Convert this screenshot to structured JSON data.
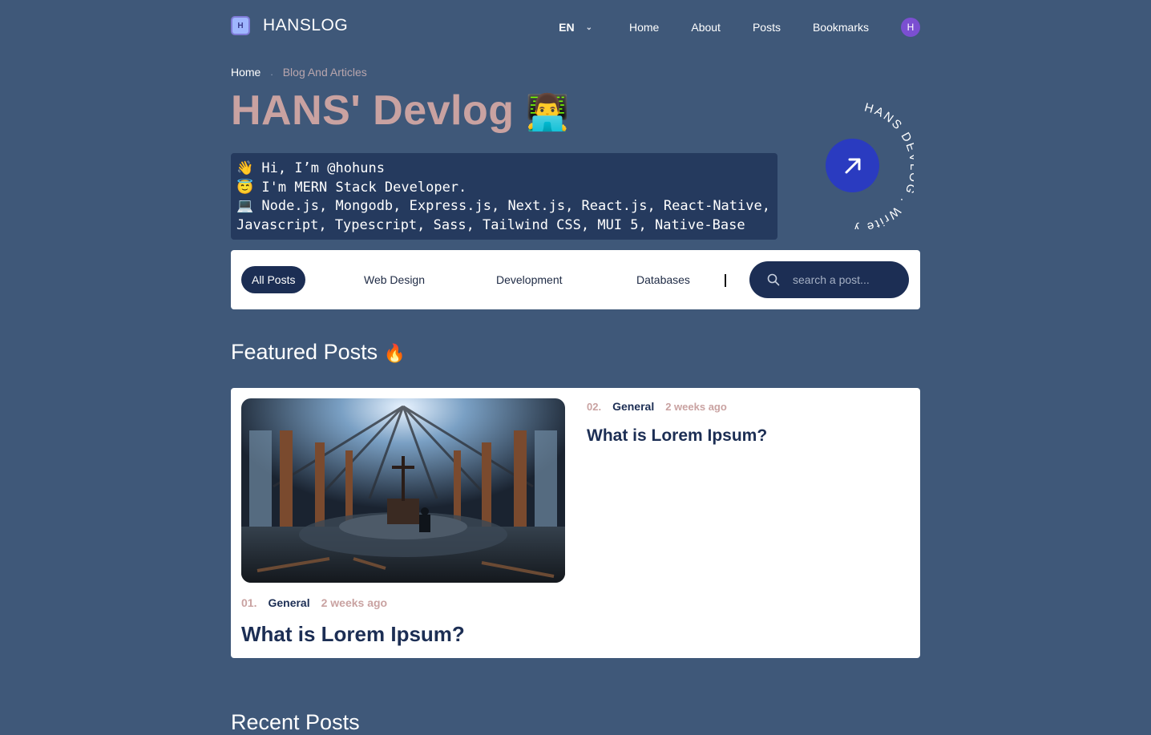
{
  "nav": {
    "logo_letter": "H",
    "brand": "HANSLOG",
    "language": "EN",
    "links": [
      "Home",
      "About",
      "Posts",
      "Bookmarks"
    ],
    "avatar_letter": "H"
  },
  "breadcrumb": {
    "home": "Home",
    "separator": ".",
    "current": "Blog And Articles"
  },
  "hero": {
    "title": "HANS' Devlog",
    "title_emoji": "👨‍💻",
    "intro_lines": [
      "👋 Hi, I’m @hohuns",
      "😇 I'm MERN Stack Developer.",
      "💻 Node.js, Mongodb, Express.js, Next.js, React.js, React-Native,",
      "Javascript, Typescript, Sass, Tailwind CSS, MUI 5, Native-Base"
    ],
    "badge_text": "HANS DEVLOG . Write your thoughts ."
  },
  "filters": {
    "tabs": [
      "All Posts",
      "Web Design",
      "Development",
      "Databases"
    ],
    "active_tab": "All Posts",
    "search_placeholder": "search a post..."
  },
  "featured": {
    "heading": "Featured Posts",
    "heading_emoji": "🔥",
    "posts": [
      {
        "index": "01.",
        "category": "General",
        "time": "2 weeks ago",
        "title": "What is Lorem Ipsum?"
      },
      {
        "index": "02.",
        "category": "General",
        "time": "2 weeks ago",
        "title": "What is Lorem Ipsum?"
      }
    ]
  },
  "recent": {
    "heading": "Recent Posts"
  },
  "colors": {
    "background": "#3f5879",
    "accent": "#c9a2a1",
    "navy": "#1c2e54",
    "badge_button": "#2a3bc0",
    "avatar": "#7b4fd1"
  }
}
